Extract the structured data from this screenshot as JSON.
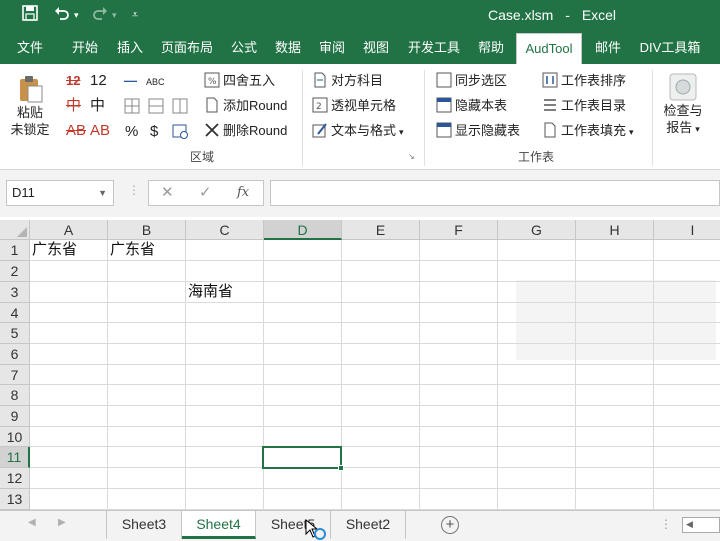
{
  "window": {
    "filename": "Case.xlsm",
    "separator": "-",
    "app": "Excel"
  },
  "quick_access": {
    "save": "save-icon",
    "undo": "undo-icon",
    "redo": "redo-icon",
    "customize": "customize-qat-icon"
  },
  "tabs": [
    "文件",
    "开始",
    "插入",
    "页面布局",
    "公式",
    "数据",
    "审阅",
    "视图",
    "开发工具",
    "帮助",
    "AudTool",
    "邮件",
    "DIV工具箱"
  ],
  "active_tab": "AudTool",
  "ribbon": {
    "paste": {
      "line1": "粘贴",
      "line2": "未锁定"
    },
    "case_grid": {
      "r1a": "12",
      "r1b": "12",
      "r2a": "中",
      "r2b": "中",
      "r3a": "AB",
      "r3b": "AB"
    },
    "symbols": {
      "abc": "ABC",
      "percent": "%",
      "dollar": "$"
    },
    "region_buttons": [
      "四舍五入",
      "添加Round",
      "删除Round"
    ],
    "mid_buttons": [
      "对方科目",
      "透视单元格",
      "文本与格式"
    ],
    "sheet_buttons_a": [
      "同步选区",
      "隐藏本表",
      "显示隐藏表"
    ],
    "sheet_buttons_b": [
      "工作表排序",
      "工作表目录",
      "工作表填充"
    ],
    "check_report": {
      "line1": "检查与",
      "line2": "报告"
    },
    "groups": {
      "region": "区域",
      "worksheet": "工作表"
    }
  },
  "formula_bar": {
    "name_box": "D11",
    "cancel": "✕",
    "enter": "✓",
    "fx": "fx",
    "formula": ""
  },
  "columns": [
    "A",
    "B",
    "C",
    "D",
    "E",
    "F",
    "G",
    "H",
    "I"
  ],
  "rows": [
    "1",
    "2",
    "3",
    "4",
    "5",
    "6",
    "7",
    "8",
    "9",
    "10",
    "11",
    "12",
    "13"
  ],
  "selected": {
    "cell": "D11",
    "column": "D",
    "row": "11"
  },
  "cells": {
    "A1": "广东省",
    "B1": "广东省",
    "C3": "海南省"
  },
  "sheets": [
    "Sheet3",
    "Sheet4",
    "Sheet5",
    "Sheet2"
  ],
  "active_sheet": "Sheet4",
  "colors": {
    "brand": "#217346",
    "gridline": "#dadada",
    "header": "#e6e6e6"
  }
}
